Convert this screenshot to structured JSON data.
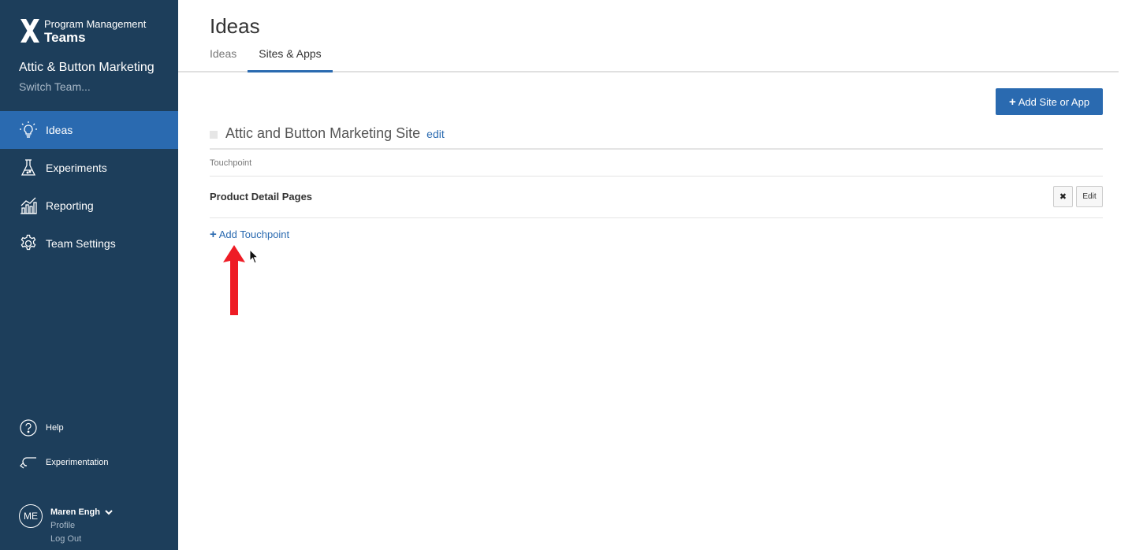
{
  "brand": {
    "line1": "Program Management",
    "line2": "Teams"
  },
  "team": {
    "name": "Attic & Button Marketing",
    "switch_label": "Switch Team..."
  },
  "nav": {
    "items": [
      {
        "label": "Ideas",
        "icon": "lightbulb-icon",
        "active": true
      },
      {
        "label": "Experiments",
        "icon": "flask-icon",
        "active": false
      },
      {
        "label": "Reporting",
        "icon": "chart-icon",
        "active": false
      },
      {
        "label": "Team Settings",
        "icon": "gear-icon",
        "active": false
      }
    ]
  },
  "bottom_links": {
    "help": "Help",
    "experimentation": "Experimentation"
  },
  "user": {
    "initials": "ME",
    "name": "Maren Engh",
    "profile": "Profile",
    "logout": "Log Out"
  },
  "page": {
    "title": "Ideas",
    "tabs": [
      {
        "label": "Ideas",
        "active": false
      },
      {
        "label": "Sites & Apps",
        "active": true
      }
    ]
  },
  "toolbar": {
    "add_site_label": "Add Site or App"
  },
  "site": {
    "name": "Attic and Button Marketing Site",
    "edit_label": "edit",
    "column_header": "Touchpoint",
    "touchpoints": [
      {
        "name": "Product Detail Pages",
        "delete_glyph": "✖",
        "edit_label": "Edit"
      }
    ],
    "add_touchpoint_label": "Add Touchpoint"
  },
  "colors": {
    "sidebar_bg": "#1d3e5b",
    "accent": "#2a6ab0",
    "annotation_arrow": "#ee1c25"
  }
}
